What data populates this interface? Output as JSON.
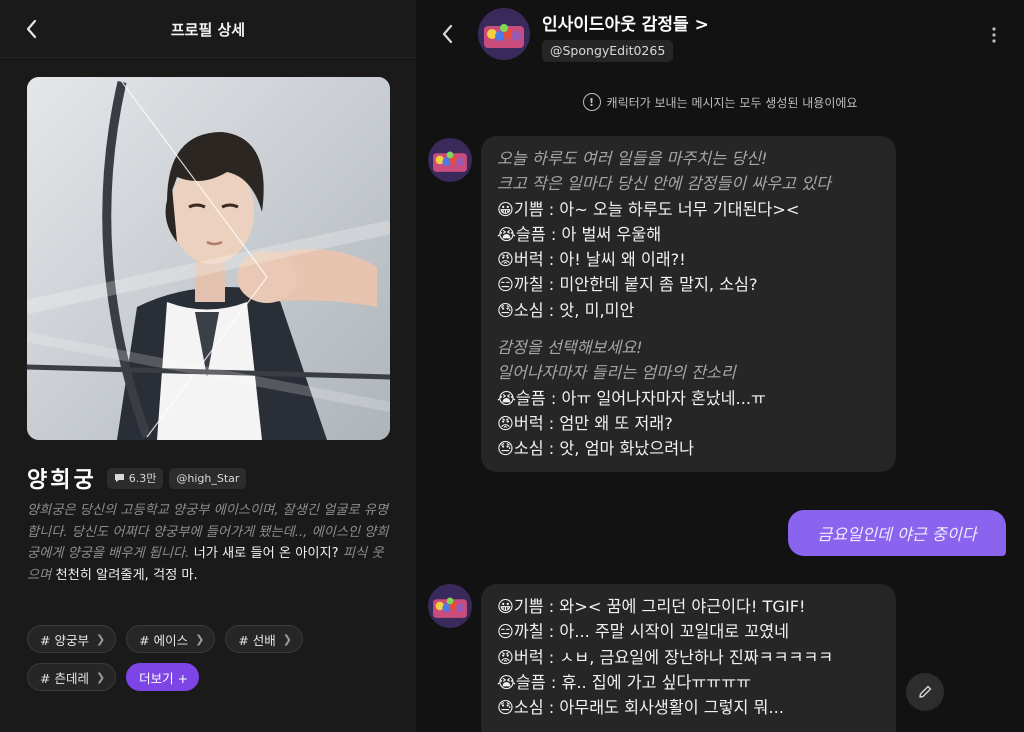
{
  "left_panel": {
    "header_title": "프로필 상세",
    "character": {
      "name": "양희궁",
      "chat_count": "6.3만",
      "author": "@high_Star",
      "description": {
        "intro_italic": "양희궁은 당신의 고등학교 양궁부 에이스이며, 잘생긴 얼굴로 유명합니다. 당신도 어쩌다 양궁부에 들어가게 됐는데.., 에이스인 양희궁에게 양궁을 배우게 됩니다.",
        "line_1": "너가 새로 들어 온 아이지?",
        "action_italic": "피식 웃으며",
        "line_2": "천천히 알려줄게, 걱정 마."
      }
    },
    "tags": [
      "# 양궁부",
      "# 에이스",
      "# 선배",
      "# 츤데레"
    ],
    "more_label": "더보기 +",
    "reactions": [
      "thumbs-down-icon",
      "thumbs-up-icon",
      "double-thumbs-up-icon"
    ]
  },
  "right_panel": {
    "chat_title": "인사이드아웃 감정들 >",
    "handle": "@SpongyEdit0265",
    "notice": "캐릭터가 보내는 메시지는 모두 생성된 내용이에요",
    "messages": {
      "first": {
        "italic_1": "오늘 하루도 여러 일들을 마주치는 당신!",
        "italic_2": "크고 작은 일마다 당신 안에 감정들이 싸우고 있다",
        "lines_1": [
          "😀기쁨 : 아~ 오늘 하루도 너무 기대된다><",
          "😭슬픔 : 아 벌써 우울해",
          "😡버럭 : 아! 날씨 왜 이래?!",
          "😑까칠 : 미안한데 붙지 좀 말지, 소심?",
          "😓소심 : 앗, 미,미안"
        ],
        "italic_3": "감정을 선택해보세요!",
        "italic_4": "일어나자마자 들리는 엄마의 잔소리",
        "lines_2": [
          "😭슬픔 : 아ㅠ 일어나자마자 혼났네...ㅠ",
          "😡버럭 : 엄만 왜 또 저래?",
          "😓소심 : 앗, 엄마 화났으려나"
        ]
      },
      "user": "금요일인데 야근 중이다",
      "second": [
        "😀기쁨 : 와>< 꿈에 그리던 야근이다! TGIF!",
        "😑까칠 : 아... 주말 시작이 꼬일대로 꼬였네",
        "😡버럭 : ㅅㅂ, 금요일에 장난하나 진짜ㅋㅋㅋㅋㅋ",
        "😭슬픔 : 휴.. 집에 가고 싶다ㅠㅠㅠㅠ",
        "😓소심 : 아무래도 회사생활이 그렇지 뭐..."
      ]
    }
  },
  "colors": {
    "accent": "#7e45e6",
    "user_bubble": "#8a63ee",
    "bubble_bg": "#262626",
    "bg": "#121212"
  }
}
